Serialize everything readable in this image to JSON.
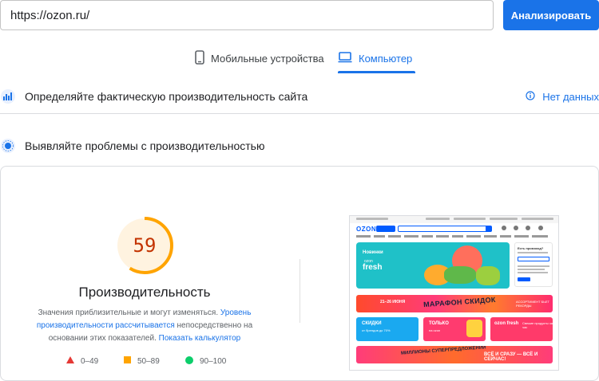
{
  "search": {
    "url_value": "https://ozon.ru/",
    "analyze_label": "Анализировать"
  },
  "tabs": [
    {
      "label": "Мобильные устройства",
      "icon": "phone-icon",
      "active": false
    },
    {
      "label": "Компьютер",
      "icon": "desktop-icon",
      "active": true
    }
  ],
  "field_data": {
    "title": "Определяйте фактическую производительность сайта",
    "no_data_label": "Нет данных"
  },
  "lab_data": {
    "title": "Выявляйте проблемы с производительностью"
  },
  "performance": {
    "score": "59",
    "score_fraction": 0.59,
    "title": "Производительность",
    "desc_text_1": "Значения приблизительные и могут изменяться.",
    "desc_link_1": "Уровень производительности рассчитывается",
    "desc_text_2": "непосредственно на основании этих показателей.",
    "desc_link_2": "Показать калькулятор",
    "legend": [
      {
        "label": "0–49",
        "color": "#e53935",
        "shape": "triangle"
      },
      {
        "label": "50–89",
        "color": "#ffa400",
        "shape": "square"
      },
      {
        "label": "90–100",
        "color": "#0cce6b",
        "shape": "circle"
      }
    ],
    "colors": {
      "score_text": "#c33300",
      "gauge_stroke": "#ffa400",
      "gauge_fill": "#fff3e0"
    }
  },
  "preview": {
    "logo": "OZON",
    "hero_title": "Новинки",
    "hero_brand": "ozon",
    "hero_fresh": "fresh",
    "promo_title": "Есть промокод?",
    "banner1_date": "21–26 ИЮНЯ",
    "banner1_text": "МАРАФОН СКИДОК",
    "banner1_tag": "АССОРТИМЕНТ БЬЕТ РЕКОРДЫ",
    "tile1_title": "СКИДКИ",
    "tile1_sub": "от брендов до 70%",
    "tile2_title": "ТОЛЬКО",
    "tile2_sub": "на ozon",
    "tile3_title": "ozon fresh",
    "tile3_text": "Свежие продукты за час",
    "banner2_text": "МИЛЛИОНЫ СУПЕРПРЕДЛОЖЕНИЙ",
    "banner2_tag": "ВСЁ И СРАЗУ — ВСЁ И СЕЙЧАС!",
    "accent": "#005bff"
  },
  "colors": {
    "primary": "#1a73e8",
    "border": "#dadce0"
  }
}
